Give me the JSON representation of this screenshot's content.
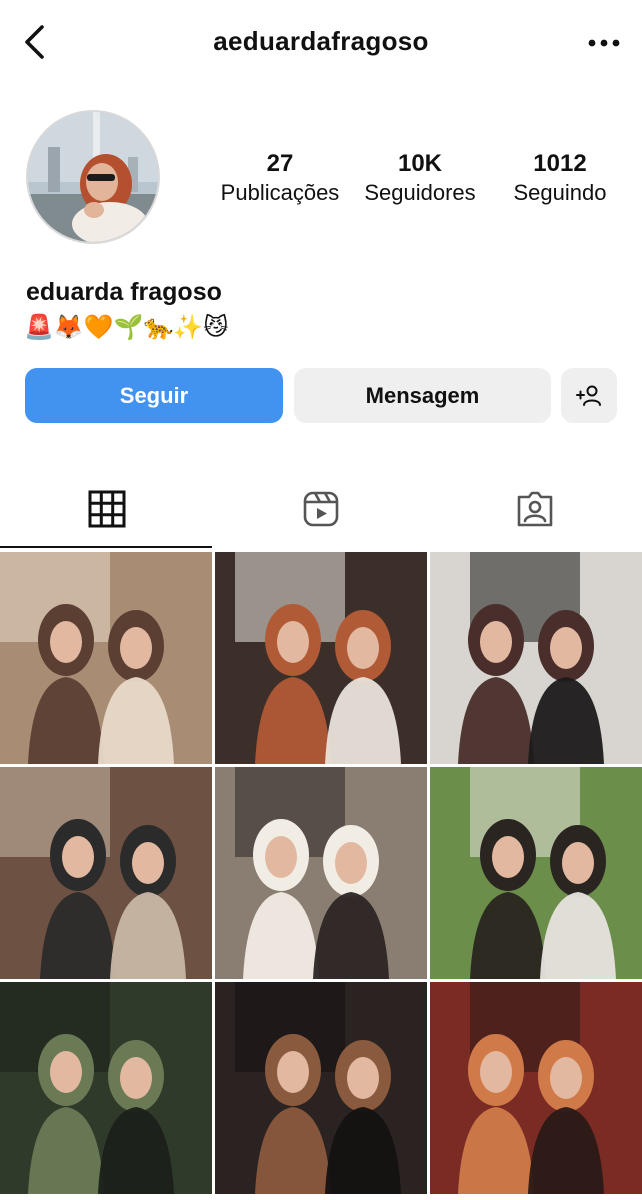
{
  "header": {
    "username": "aeduardafragoso",
    "back_icon": "chevron-left-icon",
    "more_icon": "more-horizontal-icon"
  },
  "profile": {
    "display_name": "eduarda fragoso",
    "bio": "🚨🦊🧡🌱🐆✨😼",
    "stats": [
      {
        "value": "27",
        "label": "Publicações"
      },
      {
        "value": "10K",
        "label": "Seguidores"
      },
      {
        "value": "1012",
        "label": "Seguindo"
      }
    ]
  },
  "actions": {
    "follow_label": "Seguir",
    "message_label": "Mensagem",
    "suggest_icon": "add-person-icon",
    "follow_color": "#4193ef",
    "secondary_color": "#efefef"
  },
  "tabs": [
    {
      "name": "posts",
      "icon": "grid-icon",
      "active": true
    },
    {
      "name": "reels",
      "icon": "reels-icon",
      "active": false
    },
    {
      "name": "tagged",
      "icon": "tagged-person-icon",
      "active": false
    }
  ],
  "posts": [
    {
      "id": "post-1",
      "palette": [
        "#a88c74",
        "#5b3f33",
        "#e8d9c8"
      ]
    },
    {
      "id": "post-2",
      "palette": [
        "#3c2f2a",
        "#b15a36",
        "#e9e3da"
      ]
    },
    {
      "id": "post-3",
      "palette": [
        "#d8d4cf",
        "#4a2e2b",
        "#1c1a1a"
      ]
    },
    {
      "id": "post-4",
      "palette": [
        "#6d5243",
        "#2b2b2b",
        "#c9b7a6"
      ]
    },
    {
      "id": "post-5",
      "palette": [
        "#8a7e72",
        "#f1ece4",
        "#2c2624"
      ]
    },
    {
      "id": "post-6",
      "palette": [
        "#6b8e4a",
        "#2a2520",
        "#e7e3de"
      ]
    },
    {
      "id": "post-7",
      "palette": [
        "#2f3a2a",
        "#6a7a55",
        "#1b211a"
      ]
    },
    {
      "id": "post-8",
      "palette": [
        "#2b2321",
        "#8a5a3e",
        "#141212"
      ]
    },
    {
      "id": "post-9",
      "palette": [
        "#7a2b24",
        "#d07a4a",
        "#2a1916"
      ]
    }
  ]
}
